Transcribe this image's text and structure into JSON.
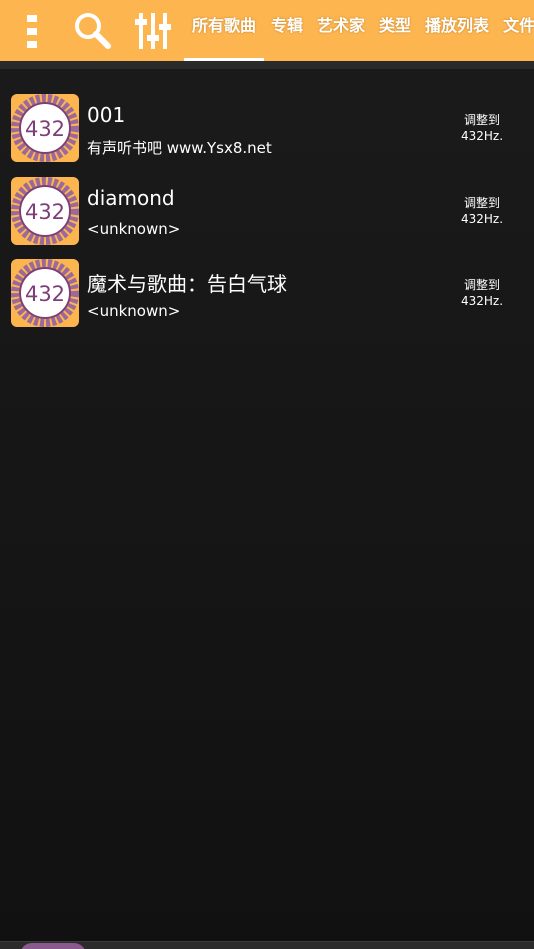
{
  "toolbar": {
    "background": "#FDB550",
    "icons": [
      "more-vert-icon",
      "search-icon",
      "equalizer-icon"
    ],
    "tabs": [
      {
        "label": "所有歌曲",
        "active": true
      },
      {
        "label": "专辑",
        "active": false
      },
      {
        "label": "艺术家",
        "active": false
      },
      {
        "label": "类型",
        "active": false
      },
      {
        "label": "播放列表",
        "active": false
      },
      {
        "label": "文件",
        "active": false
      }
    ]
  },
  "songs": [
    {
      "art_label": "432",
      "title": "001",
      "subtitle": "有声听书吧 www.Ysx8.net",
      "tune_line1": "调整到",
      "tune_line2": "432Hz."
    },
    {
      "art_label": "432",
      "title": "diamond",
      "subtitle": "<unknown>",
      "tune_line1": "调整到",
      "tune_line2": "432Hz."
    },
    {
      "art_label": "432",
      "title": "魔术与歌曲：告白气球",
      "subtitle": "<unknown>",
      "tune_line1": "调整到",
      "tune_line2": "432Hz."
    }
  ]
}
